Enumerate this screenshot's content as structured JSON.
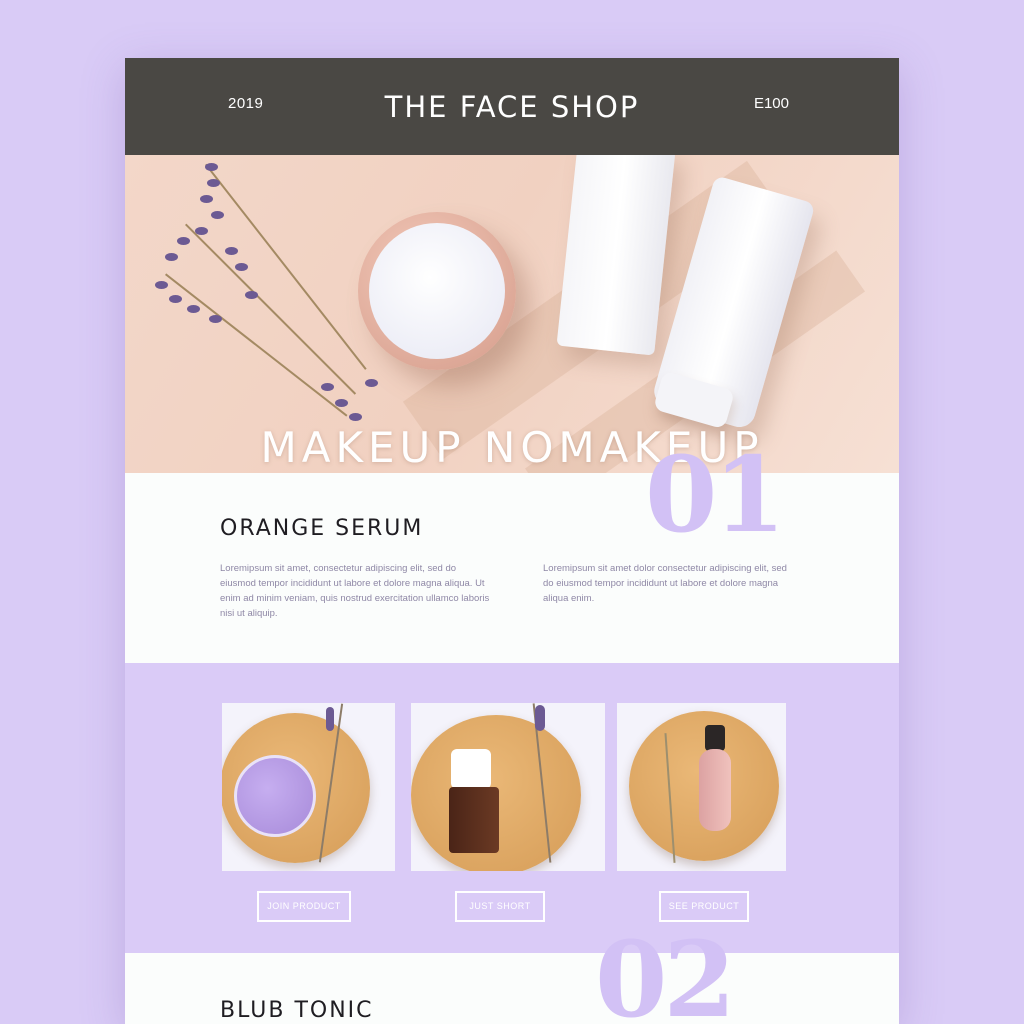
{
  "header": {
    "year": "2019",
    "brand": "THE FACE SHOP",
    "price": "E100"
  },
  "hero": {
    "headline": "MAKEUP NOMAKEUP"
  },
  "section1": {
    "number": "01",
    "title": "ORANGE SERUM",
    "paragraph_left": "Loremipsum sit amet, consectetur adipiscing elit, sed do eiusmod tempor incididunt ut labore et dolore magna aliqua. Ut enim ad minim veniam, quis nostrud exercitation ullamco laboris nisi ut aliquip.",
    "paragraph_right": "Loremipsum sit amet dolor consectetur adipiscing elit, sed do eiusmod tempor incididunt ut labore et dolore magna aliqua enim."
  },
  "products": {
    "buttons": [
      "JOIN PRODUCT",
      "JUST SHORT",
      "SEE PRODUCT"
    ]
  },
  "section2": {
    "number": "02",
    "title": "BLUB TONIC"
  },
  "colors": {
    "background": "#d9cbf6",
    "header": "#4a4844",
    "accent_lavender": "#d2c1f5",
    "products_band": "#dacbf7"
  }
}
